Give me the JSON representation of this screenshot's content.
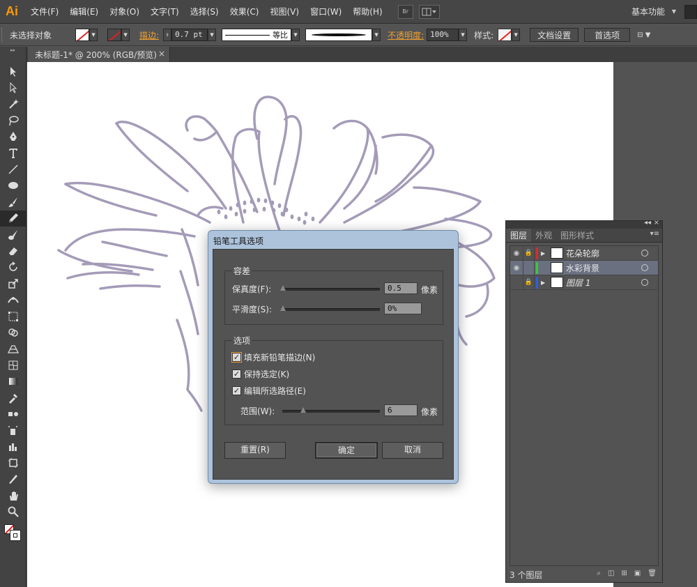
{
  "app": {
    "logo": "Ai",
    "menu": [
      "文件(F)",
      "编辑(E)",
      "对象(O)",
      "文字(T)",
      "选择(S)",
      "效果(C)",
      "视图(V)",
      "窗口(W)",
      "帮助(H)"
    ],
    "bridge_label": "Br",
    "workspace": "基本功能",
    "accent_color": "#ff9a00"
  },
  "control_bar": {
    "selection_status": "未选择对象",
    "stroke_label": "描边:",
    "stroke_weight": "0.7 pt",
    "stroke_profile": "等比",
    "opacity_label": "不透明度:",
    "opacity_value": "100%",
    "style_label": "样式:",
    "doc_setup_button": "文档设置",
    "preferences_button": "首选项"
  },
  "document": {
    "tab_title": "未标题-1* @ 200% (RGB/预览)",
    "close_glyph": "×",
    "outline_color": "#a49bb8"
  },
  "tools": [
    "selection-tool",
    "direct-selection-tool",
    "magic-wand-tool",
    "lasso-tool",
    "pen-tool",
    "type-tool",
    "line-segment-tool",
    "ellipse-tool",
    "paintbrush-tool",
    "pencil-tool",
    "blob-brush-tool",
    "eraser-tool",
    "rotate-tool",
    "scale-tool",
    "width-tool",
    "free-transform-tool",
    "shape-builder-tool",
    "perspective-grid-tool",
    "mesh-tool",
    "gradient-tool",
    "eyedropper-tool",
    "blend-tool",
    "symbol-sprayer-tool",
    "column-graph-tool",
    "artboard-tool",
    "slice-tool",
    "hand-tool",
    "zoom-tool"
  ],
  "active_tool": "pencil-tool",
  "layers_panel": {
    "tabs": [
      "图层",
      "外观",
      "图形样式"
    ],
    "active_tab": "图层",
    "layers": [
      {
        "name": "花朵轮廓",
        "color": "#e02828",
        "visible": true,
        "locked": true,
        "selected": false
      },
      {
        "name": "水彩背景",
        "color": "#3ec83e",
        "visible": true,
        "locked": false,
        "selected": true
      },
      {
        "name": "图层 1",
        "color": "#2f5fe0",
        "visible": false,
        "locked": true,
        "selected": false
      }
    ],
    "footer_count": "3 个图层"
  },
  "dialog": {
    "title": "铅笔工具选项",
    "tolerance_group": "容差",
    "fidelity_label": "保真度(F):",
    "fidelity_value": "0.5",
    "fidelity_unit": "像素",
    "smoothness_label": "平滑度(S):",
    "smoothness_value": "0%",
    "options_group": "选项",
    "fill_new_label": "填充新铅笔描边(N)",
    "fill_new_checked": true,
    "keep_selected_label": "保持选定(K)",
    "keep_selected_checked": true,
    "edit_selected_label": "编辑所选路径(E)",
    "edit_selected_checked": true,
    "within_label": "范围(W):",
    "within_value": "6",
    "within_unit": "像素",
    "reset_button": "重置(R)",
    "ok_button": "确定",
    "cancel_button": "取消",
    "check_glyph": "✓"
  }
}
